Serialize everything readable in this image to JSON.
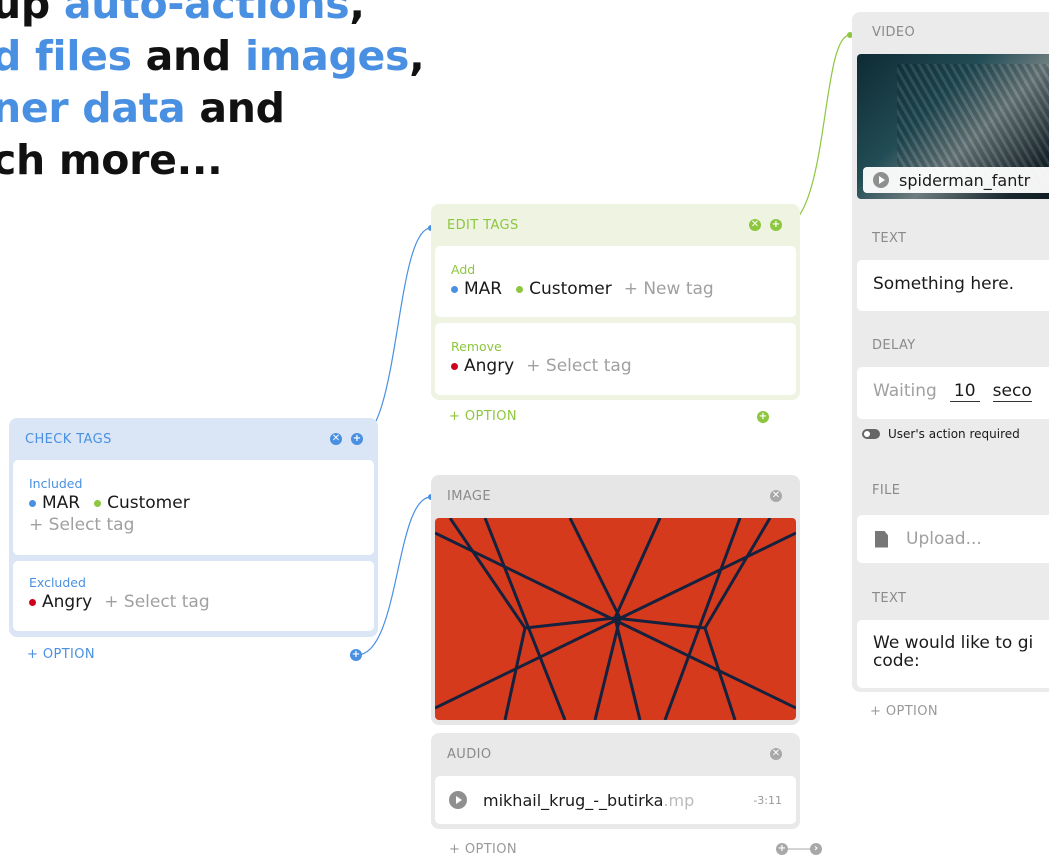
{
  "headline": {
    "line1": [
      {
        "t": "up ",
        "c": "dark"
      },
      {
        "t": "auto-actions",
        "c": "blue"
      },
      {
        "t": ",",
        "c": "dark"
      }
    ],
    "line2": [
      {
        "t": "d files",
        "c": "blue"
      },
      {
        "t": " and ",
        "c": "dark"
      },
      {
        "t": "images",
        "c": "blue"
      },
      {
        "t": ",",
        "c": "dark"
      }
    ],
    "line3": [
      {
        "t": "ner data",
        "c": "blue"
      },
      {
        "t": " and",
        "c": "dark"
      }
    ],
    "line4": [
      {
        "t": "ch more...",
        "c": "dark"
      }
    ]
  },
  "check_tags": {
    "title": "CHECK TAGS",
    "included_label": "Included",
    "included_tags": [
      {
        "name": "MAR",
        "color": "#4a90e2"
      },
      {
        "name": "Customer",
        "color": "#8dc63f"
      }
    ],
    "included_add": "+ Select tag",
    "excluded_label": "Excluded",
    "excluded_tags": [
      {
        "name": "Angry",
        "color": "#d0021b"
      }
    ],
    "excluded_add": "+ Select tag",
    "option": "+ OPTION"
  },
  "edit_tags": {
    "title": "EDIT TAGS",
    "add_label": "Add",
    "add_tags": [
      {
        "name": "MAR",
        "color": "#4a90e2"
      },
      {
        "name": "Customer",
        "color": "#8dc63f"
      }
    ],
    "add_new": "+ New tag",
    "remove_label": "Remove",
    "remove_tags": [
      {
        "name": "Angry",
        "color": "#d0021b"
      }
    ],
    "remove_add": "+ Select tag",
    "option": "+ OPTION"
  },
  "image_card": {
    "title": "IMAGE"
  },
  "audio_card": {
    "title": "AUDIO",
    "filename": "mikhail_krug_-_butirka",
    "ext": ".mp",
    "time": "-3:11",
    "option": "+ OPTION"
  },
  "right_column": {
    "video_title": "VIDEO",
    "video_filename": "spiderman_fantr",
    "text1_title": "TEXT",
    "text1_body": "Something here.",
    "delay_title": "DELAY",
    "delay_prefix": "Waiting",
    "delay_value": "10",
    "delay_unit": "seco",
    "delay_toggle_label": "User's action required",
    "file_title": "FILE",
    "file_placeholder": "Upload...",
    "text2_title": "TEXT",
    "text2_line1": "We would like to gi",
    "text2_line2": "code:",
    "option": "+ OPTION"
  },
  "colors": {
    "blue": "#4a90e2",
    "green": "#8dc63f",
    "red": "#d0021b",
    "orange": "#d63a1c",
    "navy": "#16213e"
  },
  "icons": [
    "close-icon",
    "add-icon",
    "play-icon",
    "document-icon",
    "toggle-icon",
    "arrow-right-icon"
  ]
}
